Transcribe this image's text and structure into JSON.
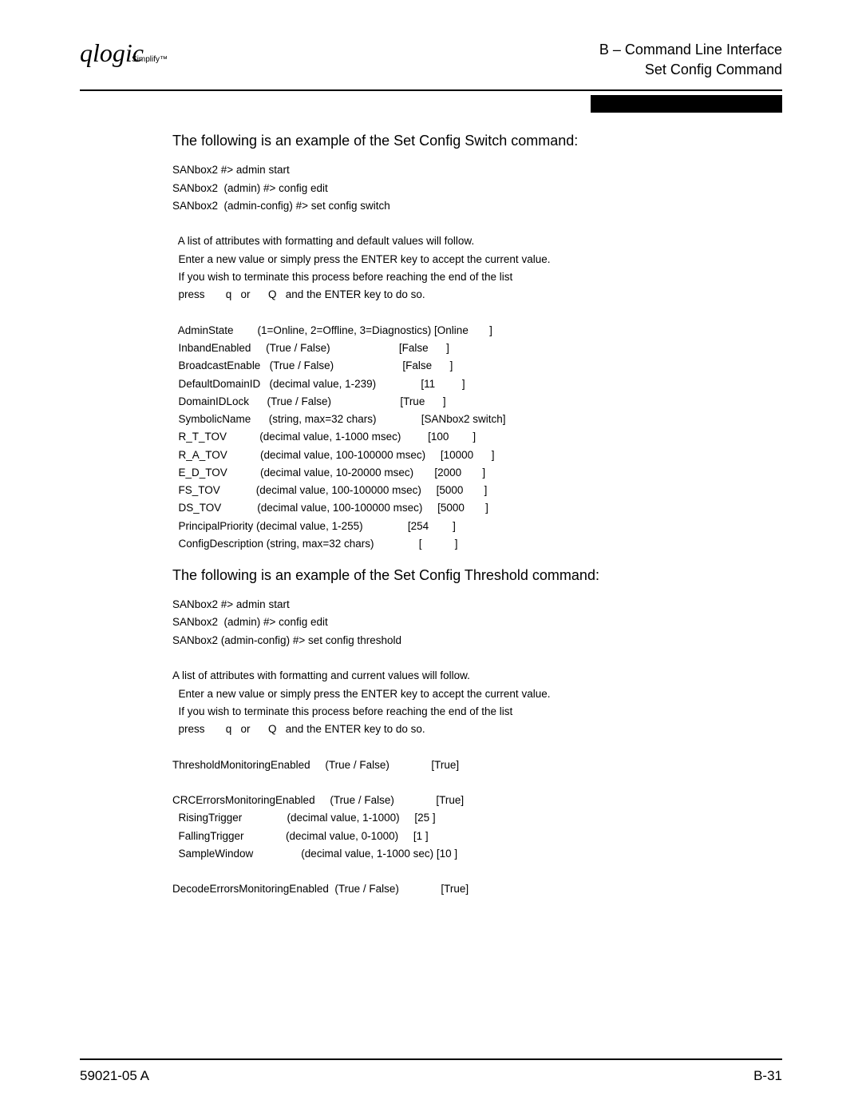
{
  "header": {
    "logo_main": "qlogic",
    "logo_sub": "Simplify™",
    "line1": "B – Command Line Interface",
    "line2": "Set Config Command"
  },
  "section1": {
    "intro": "The following is an example of the Set Config Switch command:",
    "code": "SANbox2 #> admin start\nSANbox2  (admin) #> config edit\nSANbox2  (admin-config) #> set config switch\n\n  A list of attributes with formatting and default values will follow.\n  Enter a new value or simply press the ENTER key to accept the current value.\n  If you wish to terminate this process before reaching the end of the list\n  press       q   or      Q   and the ENTER key to do so.\n\n  AdminState        (1=Online, 2=Offline, 3=Diagnostics) [Online       ]\n  InbandEnabled     (True / False)                       [False      ]\n  BroadcastEnable   (True / False)                       [False      ]\n  DefaultDomainID   (decimal value, 1-239)               [11         ]\n  DomainIDLock      (True / False)                       [True      ]\n  SymbolicName      (string, max=32 chars)               [SANbox2 switch]\n  R_T_TOV           (decimal value, 1-1000 msec)         [100        ]\n  R_A_TOV           (decimal value, 100-100000 msec)     [10000      ]\n  E_D_TOV           (decimal value, 10-20000 msec)       [2000       ]\n  FS_TOV            (decimal value, 100-100000 msec)     [5000       ]\n  DS_TOV            (decimal value, 100-100000 msec)     [5000       ]\n  PrincipalPriority (decimal value, 1-255)               [254        ]\n  ConfigDescription (string, max=32 chars)               [           ]"
  },
  "section2": {
    "intro": "The following is an example of the Set Config Threshold command:",
    "code": "SANbox2 #> admin start\nSANbox2  (admin) #> config edit\nSANbox2 (admin-config) #> set config threshold\n\nA list of attributes with formatting and current values will follow.\n  Enter a new value or simply press the ENTER key to accept the current value.\n  If you wish to terminate this process before reaching the end of the list\n  press       q   or      Q   and the ENTER key to do so.\n\nThresholdMonitoringEnabled     (True / False)              [True]\n\nCRCErrorsMonitoringEnabled     (True / False)              [True]\n  RisingTrigger               (decimal value, 1-1000)     [25 ]\n  FallingTrigger              (decimal value, 0-1000)     [1 ]\n  SampleWindow                (decimal value, 1-1000 sec) [10 ]\n\nDecodeErrorsMonitoringEnabled  (True / False)              [True]"
  },
  "footer": {
    "left": "59021-05  A",
    "right": "B-31"
  }
}
